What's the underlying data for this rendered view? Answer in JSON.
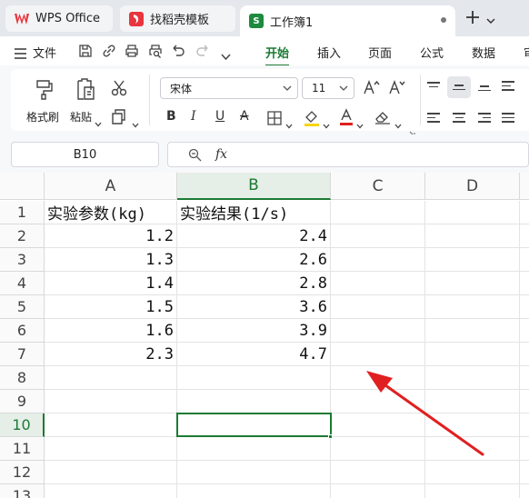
{
  "tabs": {
    "wps_label": "WPS Office",
    "templates_label": "找稻壳模板",
    "document_label": "工作簿1",
    "sheet_badge": "S"
  },
  "menu": {
    "file_label": "文件",
    "tabs": [
      "开始",
      "插入",
      "页面",
      "公式",
      "数据",
      "审"
    ]
  },
  "ribbon": {
    "format_painter_label": "格式刷",
    "paste_label": "粘贴",
    "font_name": "宋体",
    "font_size": "11"
  },
  "formula_bar": {
    "cell_ref": "B10",
    "fx_label": "fx",
    "content": ""
  },
  "sheet": {
    "columns": [
      "A",
      "B",
      "C",
      "D"
    ],
    "rows": [
      "1",
      "2",
      "3",
      "4",
      "5",
      "6",
      "7",
      "8",
      "9",
      "10",
      "11",
      "12",
      "13"
    ],
    "header_a": "实验参数(kg)",
    "header_b": "实验结果(1/s)",
    "col_a_values": [
      "1.2",
      "1.3",
      "1.4",
      "1.5",
      "1.6",
      "2.3"
    ],
    "col_b_values": [
      "2.4",
      "2.6",
      "2.8",
      "3.6",
      "3.9",
      "4.7"
    ],
    "selected_cell": "B10"
  },
  "colors": {
    "accent_green": "#1c7a34",
    "annotation_arrow": "#e02020",
    "wps_red": "#e8353e"
  }
}
